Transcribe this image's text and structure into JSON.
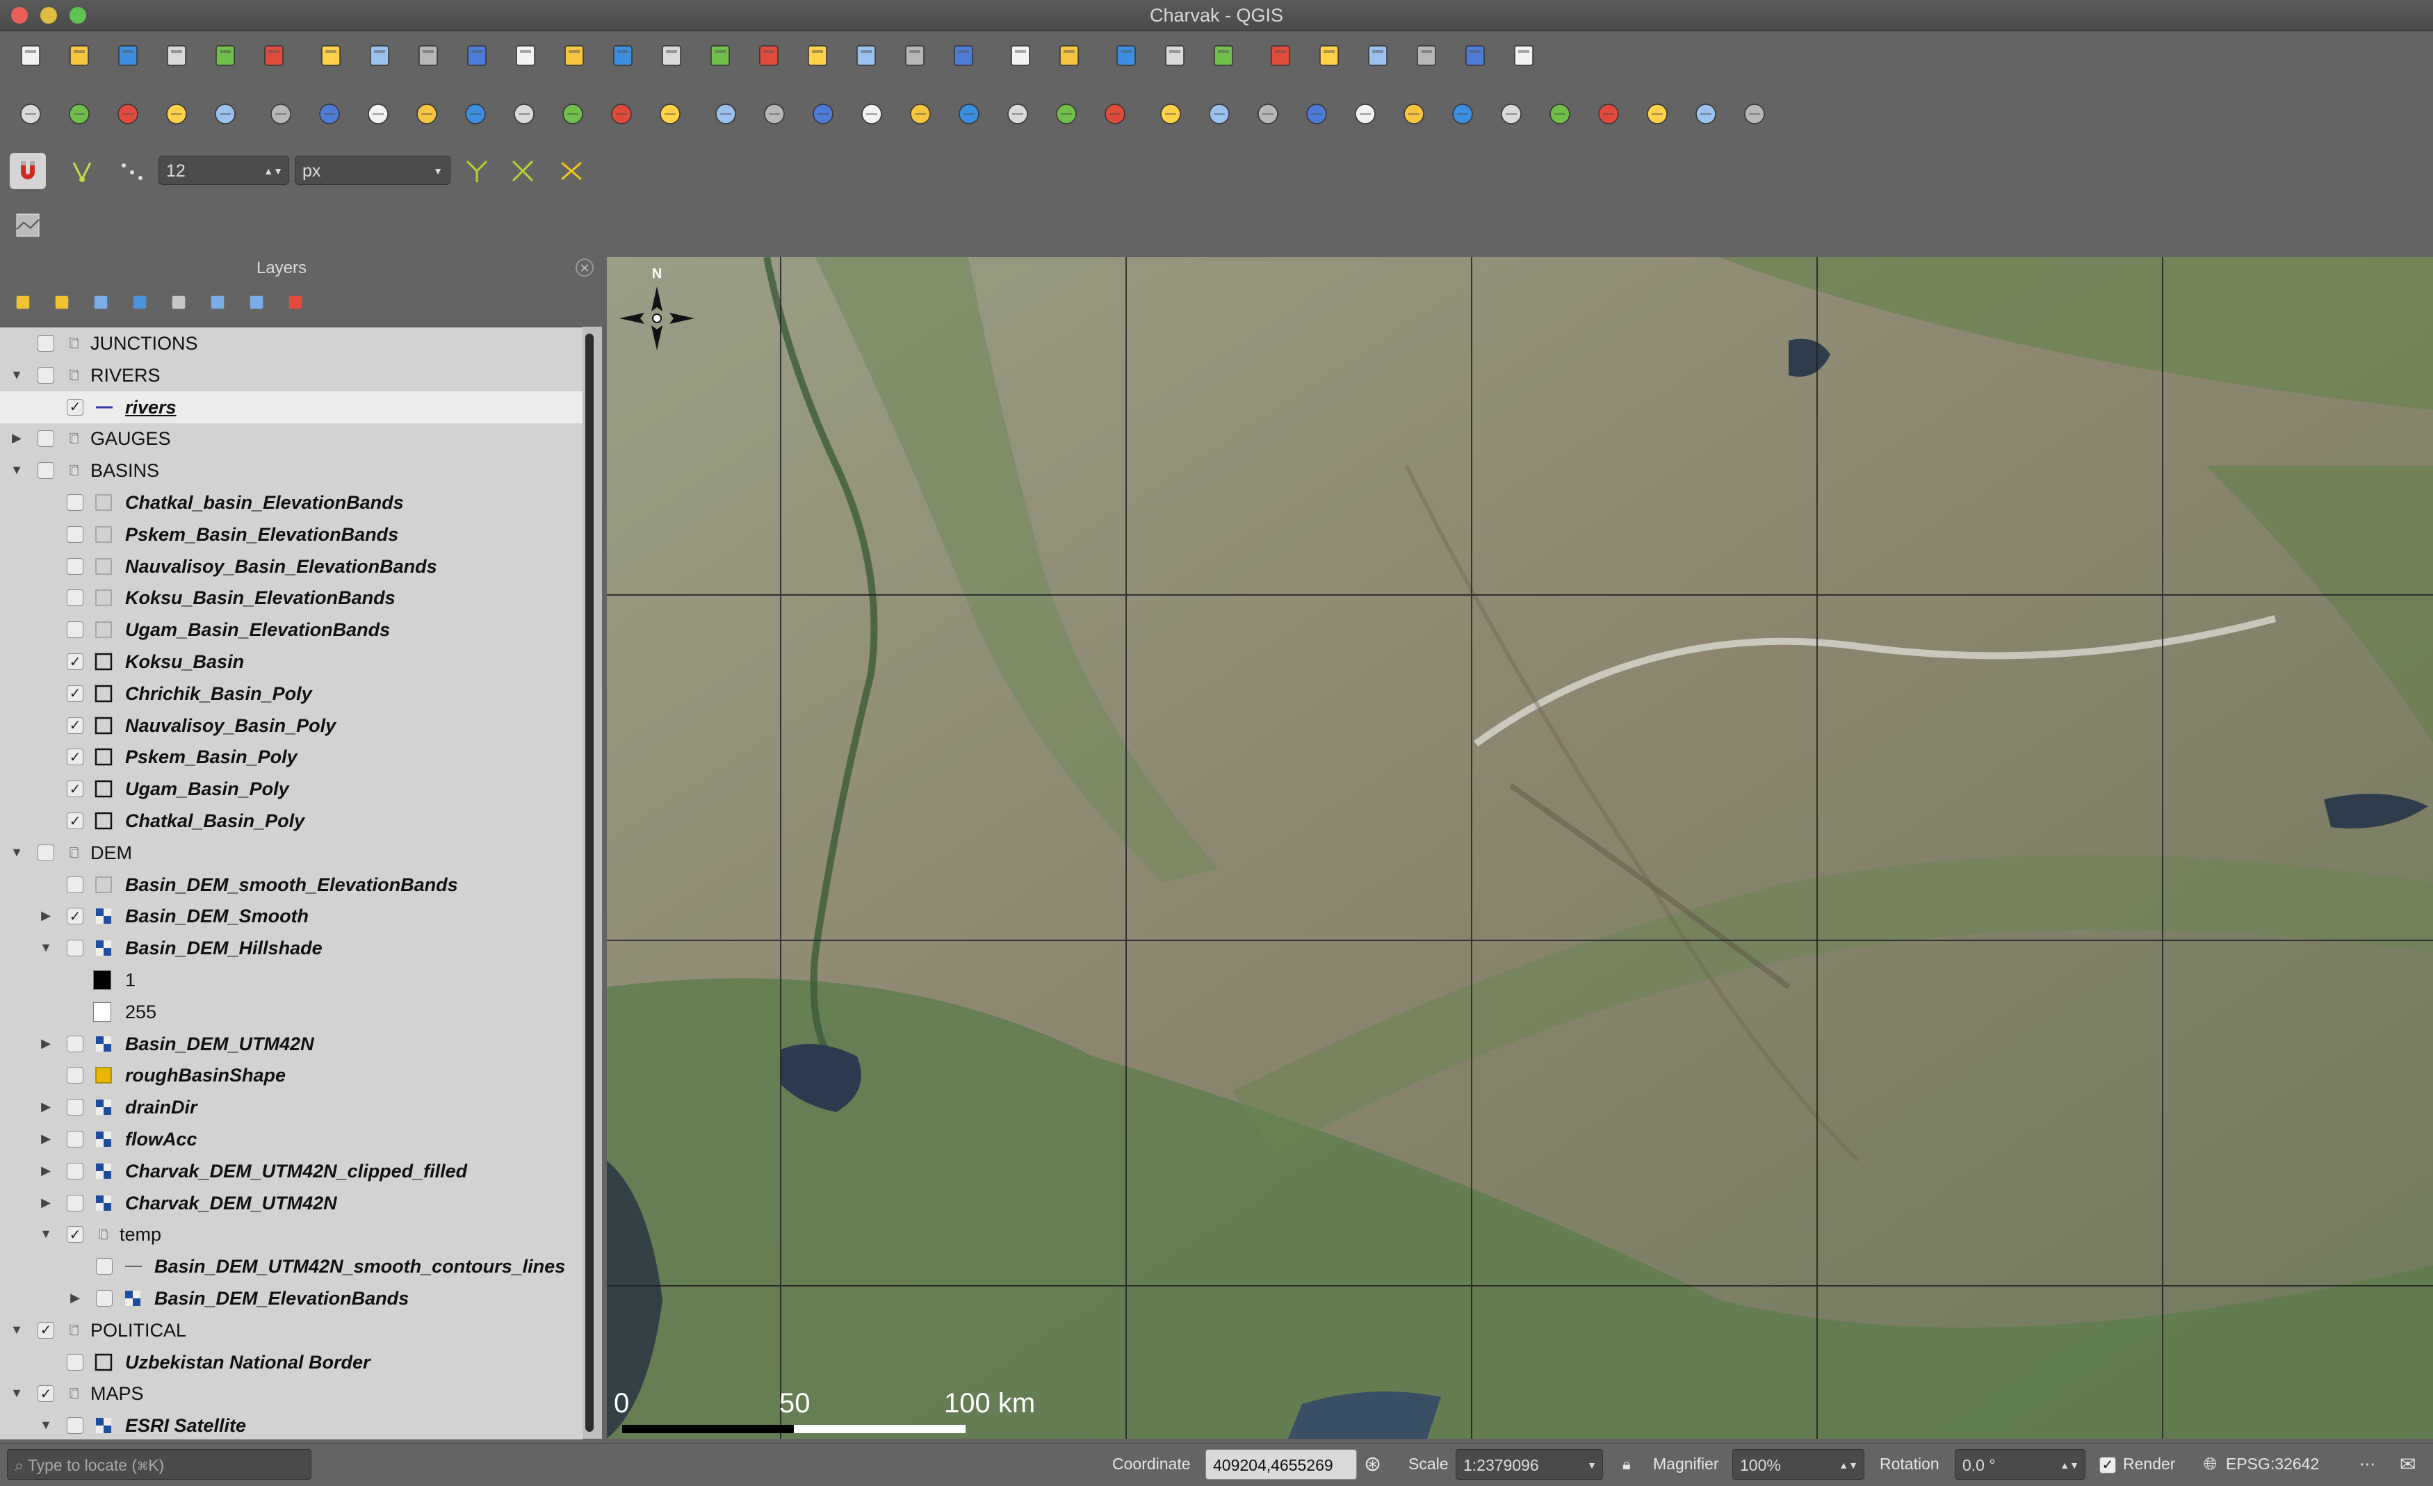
{
  "window": {
    "title": "Charvak - QGIS"
  },
  "snapping": {
    "tolerance_value": "12",
    "unit": "px"
  },
  "layers_panel": {
    "title": "Layers",
    "items": [
      {
        "label": "JUNCTIONS",
        "checked": false,
        "group": true
      },
      {
        "label": "RIVERS",
        "checked": false,
        "group": true,
        "expanded": true
      },
      {
        "label": "rivers",
        "checked": true,
        "selected": true
      },
      {
        "label": "GAUGES",
        "checked": false,
        "group": true
      },
      {
        "label": "BASINS",
        "checked": false,
        "group": true,
        "expanded": true
      },
      {
        "label": "Chatkal_basin_ElevationBands",
        "checked": false
      },
      {
        "label": "Pskem_Basin_ElevationBands",
        "checked": false
      },
      {
        "label": "Nauvalisoy_Basin_ElevationBands",
        "checked": false
      },
      {
        "label": "Koksu_Basin_ElevationBands",
        "checked": false
      },
      {
        "label": "Ugam_Basin_ElevationBands",
        "checked": false
      },
      {
        "label": "Koksu_Basin",
        "checked": true
      },
      {
        "label": "Chrichik_Basin_Poly",
        "checked": true
      },
      {
        "label": "Nauvalisoy_Basin_Poly",
        "checked": true
      },
      {
        "label": "Pskem_Basin_Poly",
        "checked": true
      },
      {
        "label": "Ugam_Basin_Poly",
        "checked": true
      },
      {
        "label": "Chatkal_Basin_Poly",
        "checked": true
      },
      {
        "label": "DEM",
        "checked": false,
        "group": true,
        "expanded": true
      },
      {
        "label": "Basin_DEM_smooth_ElevationBands",
        "checked": false
      },
      {
        "label": "Basin_DEM_Smooth",
        "checked": true
      },
      {
        "label": "Basin_DEM_Hillshade",
        "checked": false,
        "expanded": true
      },
      {
        "label": "1",
        "legend": true
      },
      {
        "label": "255",
        "legend": true
      },
      {
        "label": "Basin_DEM_UTM42N",
        "checked": false
      },
      {
        "label": "roughBasinShape",
        "checked": false
      },
      {
        "label": "drainDir",
        "checked": false
      },
      {
        "label": "flowAcc",
        "checked": false
      },
      {
        "label": "Charvak_DEM_UTM42N_clipped_filled",
        "checked": false
      },
      {
        "label": "Charvak_DEM_UTM42N",
        "checked": false
      },
      {
        "label": "temp",
        "checked": true,
        "group": true,
        "expanded": true
      },
      {
        "label": "Basin_DEM_UTM42N_smooth_contours_lines",
        "checked": false
      },
      {
        "label": "Basin_DEM_ElevationBands",
        "checked": false
      },
      {
        "label": "POLITICAL",
        "checked": true,
        "group": true,
        "expanded": true
      },
      {
        "label": "Uzbekistan National Border",
        "checked": false
      },
      {
        "label": "MAPS",
        "checked": true,
        "group": true,
        "expanded": true
      },
      {
        "label": "ESRI Satellite",
        "checked": false
      }
    ]
  },
  "map": {
    "north_label": "N",
    "scalebar": {
      "tick_0": "0",
      "tick_50": "50",
      "tick_100": "100 km"
    }
  },
  "status_bar": {
    "locate_placeholder": "Type to locate (⌘K)",
    "coordinate_label": "Coordinate",
    "coordinate_value": "409204,4655269",
    "scale_label": "Scale",
    "scale_value": "1:2379096",
    "magnifier_label": "Magnifier",
    "magnifier_value": "100%",
    "rotation_label": "Rotation",
    "rotation_value": "0.0 °",
    "render_label": "Render",
    "crs_label": "EPSG:32642"
  }
}
